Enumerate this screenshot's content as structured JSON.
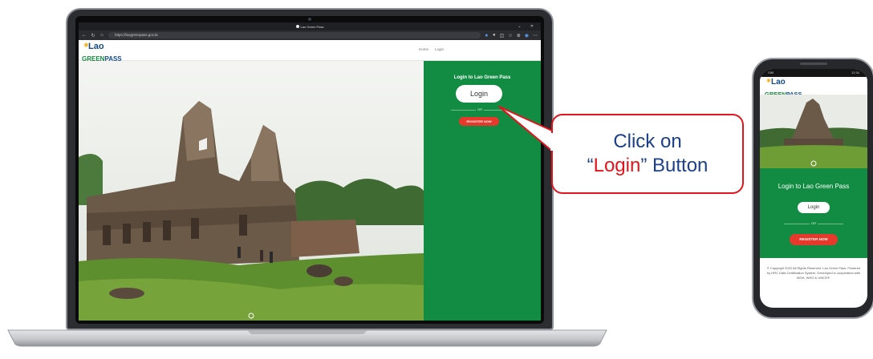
{
  "browser": {
    "tab_title": "Lao Green Pass",
    "url": "https://laogreenpass.gov.la",
    "nav": [
      "Home",
      "Login"
    ]
  },
  "site": {
    "logo_top": "Lao",
    "logo_green": "GREEN",
    "logo_pass": "PASS"
  },
  "login_panel": {
    "title": "Login to Lao Green Pass",
    "login_label": "Login",
    "or_label": "OR",
    "register_label": "REGISTER NOW"
  },
  "callout": {
    "line1": "Click on",
    "open_quote": "“",
    "highlight": "Login",
    "close_rest": "” Button"
  },
  "phone": {
    "status_left": "SIM",
    "status_right": "12:34",
    "footer": "© Copyright 2022 All Rights Reserved. Lao Green Pass. Powered by HRC Data Certification System. Developed in cooperation with MOH, WHO & UNICEF."
  },
  "colors": {
    "panel_green": "#128c43",
    "register_red": "#e6392b",
    "callout_red": "#e3141b",
    "callout_text": "#1c3f8c"
  }
}
